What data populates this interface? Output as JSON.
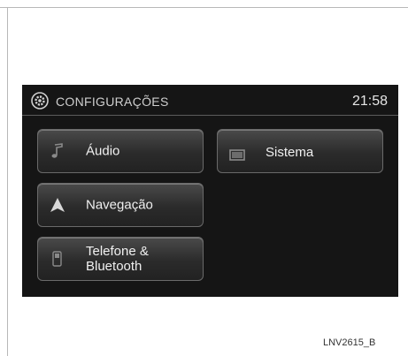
{
  "header": {
    "title": "CONFIGURAÇÕES",
    "clock": "21:58",
    "icon": "settings-gear-icon"
  },
  "menu": {
    "items": [
      {
        "id": "audio",
        "label": "Áudio",
        "icon": "music-note-icon"
      },
      {
        "id": "navegacao",
        "label": "Navegação",
        "icon": "navigation-arrow-icon"
      },
      {
        "id": "telefone",
        "label": "Telefone &\nBluetooth",
        "icon": "phone-icon"
      },
      {
        "id": "sistema",
        "label": "Sistema",
        "icon": "system-screen-icon"
      }
    ]
  },
  "figure_code": "LNV2615_B",
  "colors": {
    "screen_bg": "#151515",
    "button_border": "#6a6a6a",
    "text": "#f0f0f0"
  }
}
